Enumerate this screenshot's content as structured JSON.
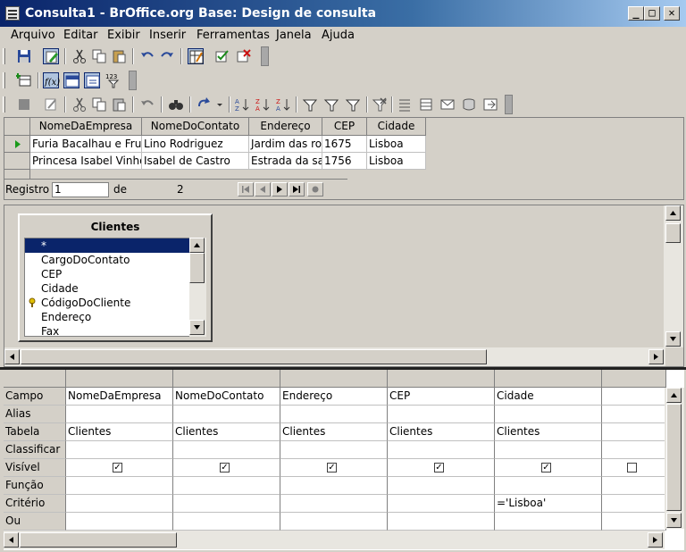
{
  "window": {
    "title": "Consulta1 - BrOffice.org Base: Design de consulta",
    "min": "_",
    "max": "□",
    "close": "✕"
  },
  "menu": [
    "Arquivo",
    "Editar",
    "Exibir",
    "Inserir",
    "Ferramentas",
    "Janela",
    "Ajuda"
  ],
  "toolbar3": {
    "extra_label": "123"
  },
  "results": {
    "columns": [
      "NomeDaEmpresa",
      "NomeDoContato",
      "Endereço",
      "CEP",
      "Cidade"
    ],
    "rows": [
      [
        "Furia Bacalhau e Frut",
        "Lino Rodriguez",
        "Jardim das ro",
        "1675",
        "Lisboa"
      ],
      [
        "Princesa Isabel Vinho",
        "Isabel de Castro",
        "Estrada da sa",
        "1756",
        "Lisboa"
      ]
    ],
    "record_label": "Registro",
    "record_value": "1",
    "of_label": "de",
    "total": "2"
  },
  "table_window": {
    "title": "Clientes",
    "fields": [
      "*",
      "CargoDoContato",
      "CEP",
      "Cidade",
      "CódigoDoCliente",
      "Endereço",
      "Fax"
    ],
    "selected_index": 0,
    "key_field_index": 4
  },
  "design_grid": {
    "row_labels": [
      "Campo",
      "Alias",
      "Tabela",
      "Classificar",
      "Visível",
      "Função",
      "Critério",
      "Ou"
    ],
    "columns": [
      {
        "campo": "NomeDaEmpresa",
        "tabela": "Clientes",
        "visivel": true,
        "criterio": ""
      },
      {
        "campo": "NomeDoContato",
        "tabela": "Clientes",
        "visivel": true,
        "criterio": ""
      },
      {
        "campo": "Endereço",
        "tabela": "Clientes",
        "visivel": true,
        "criterio": ""
      },
      {
        "campo": "CEP",
        "tabela": "Clientes",
        "visivel": true,
        "criterio": ""
      },
      {
        "campo": "Cidade",
        "tabela": "Clientes",
        "visivel": true,
        "criterio": "='Lisboa'"
      },
      {
        "campo": "",
        "tabela": "",
        "visivel": false,
        "criterio": ""
      }
    ],
    "check_mark": "✓"
  },
  "colors": {
    "title_start": "#0a246a",
    "title_end": "#a6caf0",
    "selection": "#0a246a",
    "face": "#d4d0c8",
    "row_marker": "#1a9a1a"
  }
}
